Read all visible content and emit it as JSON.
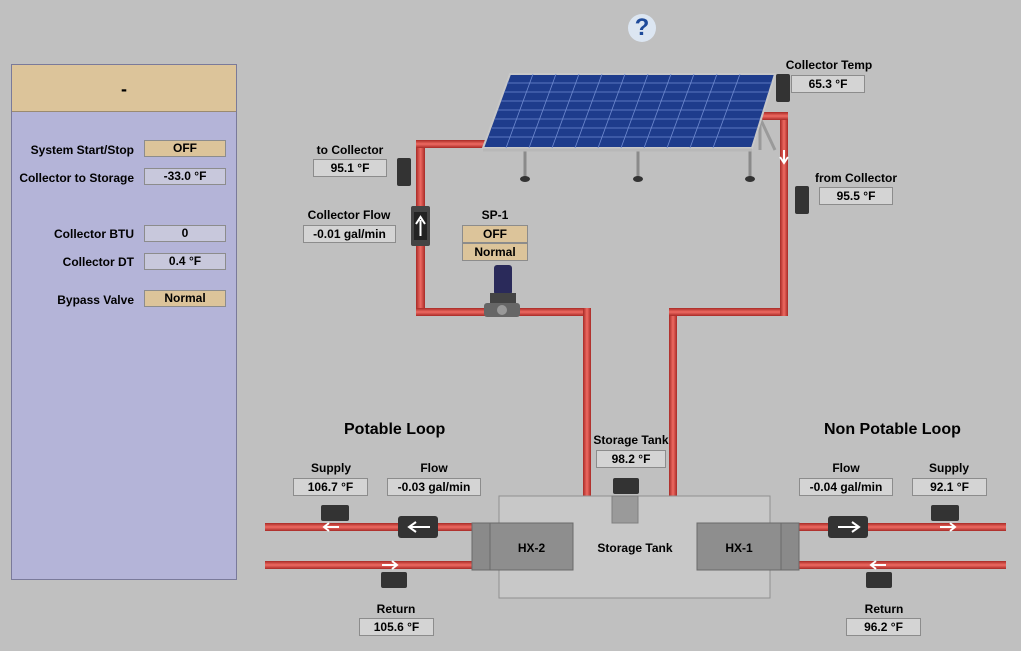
{
  "help": {
    "glyph": "?"
  },
  "panel": {
    "title": "-",
    "rows": [
      {
        "label": "System Start/Stop",
        "value": "OFF"
      },
      {
        "label": "Collector to Storage",
        "value": "-33.0 °F"
      },
      {
        "label": "Collector BTU",
        "value": "0"
      },
      {
        "label": "Collector DT",
        "value": "0.4 °F"
      },
      {
        "label": "Bypass Valve",
        "value": "Normal"
      }
    ]
  },
  "collector": {
    "temp_label": "Collector Temp",
    "temp_value": "65.3 °F",
    "to_label": "to Collector",
    "to_value": "95.1 °F",
    "from_label": "from Collector",
    "from_value": "95.5 °F",
    "flow_label": "Collector Flow",
    "flow_value": "-0.01 gal/min"
  },
  "pump": {
    "name": "SP-1",
    "state": "OFF",
    "mode": "Normal"
  },
  "storage": {
    "label": "Storage Tank",
    "temp": "98.2 °F",
    "tank_label": "Storage Tank",
    "hx2": "HX-2",
    "hx1": "HX-1"
  },
  "potable": {
    "title": "Potable Loop",
    "supply_label": "Supply",
    "supply_value": "106.7 °F",
    "flow_label": "Flow",
    "flow_value": "-0.03 gal/min",
    "return_label": "Return",
    "return_value": "105.6 °F"
  },
  "nonpotable": {
    "title": "Non Potable Loop",
    "flow_label": "Flow",
    "flow_value": "-0.04 gal/min",
    "supply_label": "Supply",
    "supply_value": "92.1 °F",
    "return_label": "Return",
    "return_value": "96.2 °F"
  },
  "colors": {
    "pipe": "#d9403a",
    "panel": "#b4b4d8",
    "header": "#dcc49a",
    "solar": "#1e3c8c"
  }
}
